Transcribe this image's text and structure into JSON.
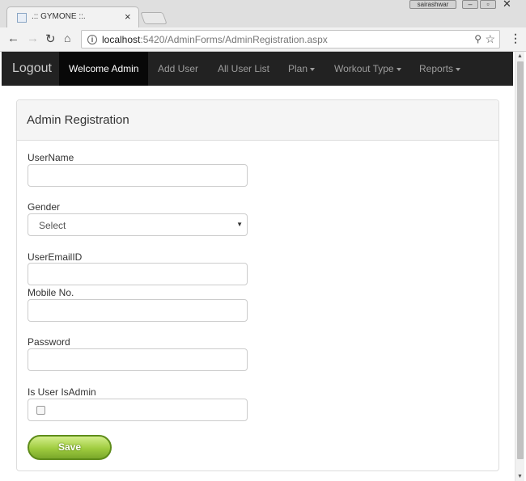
{
  "browser": {
    "tab_title": ".:: GYMONE ::.",
    "tab_close": "×",
    "user_badge": "sairashwar",
    "url_host": "localhost",
    "url_path": ":5420/AdminForms/AdminRegistration.aspx",
    "icons": [
      "back-icon",
      "forward-icon",
      "reload-icon",
      "home-icon",
      "info-icon",
      "key-icon",
      "star-icon",
      "menu-icon"
    ]
  },
  "navbar": {
    "brand": "Logout",
    "items": [
      {
        "label": "Welcome Admin",
        "active": true
      },
      {
        "label": "Add User"
      },
      {
        "label": "All User List"
      },
      {
        "label": "Plan",
        "dropdown": true
      },
      {
        "label": "Workout Type",
        "dropdown": true
      },
      {
        "label": "Reports",
        "dropdown": true
      }
    ]
  },
  "form": {
    "title": "Admin Registration",
    "username_label": "UserName",
    "username_value": "",
    "gender_label": "Gender",
    "gender_selected": "Select",
    "email_label": "UserEmailID",
    "email_value": "",
    "mobile_label": "Mobile No.",
    "mobile_value": "",
    "password_label": "Password",
    "password_value": "",
    "isadmin_label": "Is User IsAdmin",
    "isadmin_checked": false,
    "save_label": "Save"
  },
  "colors": {
    "navbar_bg": "#222222",
    "active_nav_bg": "#080808",
    "save_button": "#9fcc3f"
  }
}
